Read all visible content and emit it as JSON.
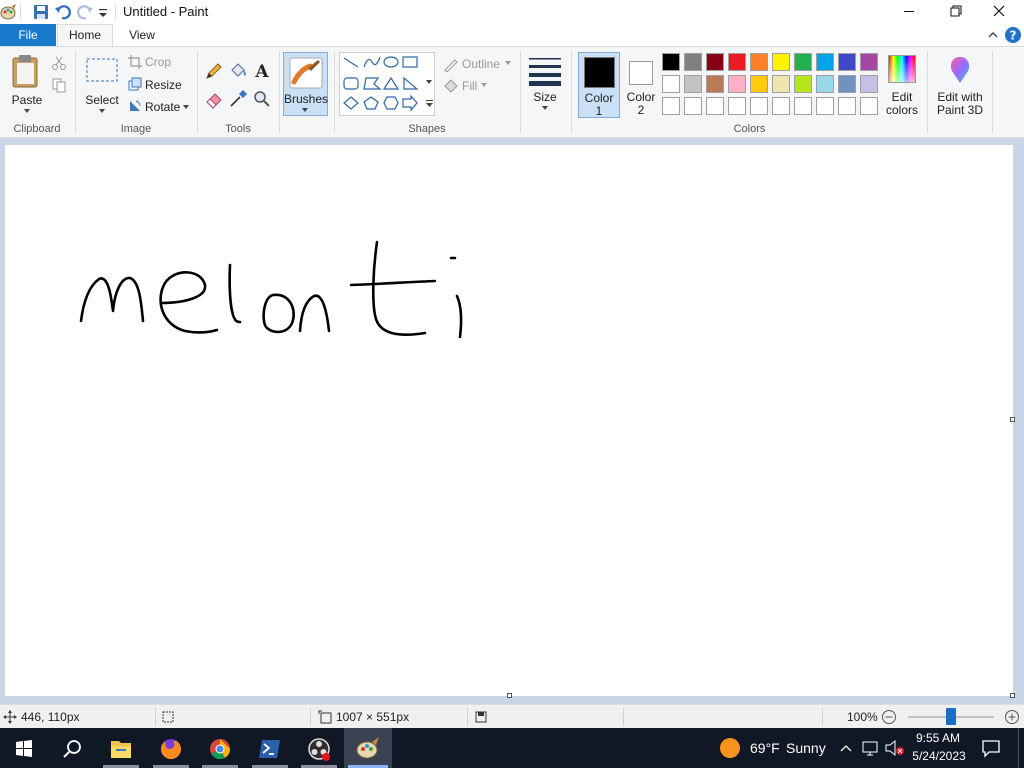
{
  "window": {
    "title": "Untitled - Paint"
  },
  "tabs": {
    "file": "File",
    "home": "Home",
    "view": "View"
  },
  "clipboard": {
    "paste": "Paste",
    "group": "Clipboard"
  },
  "image": {
    "select": "Select",
    "crop": "Crop",
    "resize": "Resize",
    "rotate": "Rotate",
    "group": "Image"
  },
  "tools": {
    "group": "Tools",
    "text_tool_glyph": "A"
  },
  "brushes": {
    "label": "Brushes"
  },
  "shapes": {
    "outline": "Outline",
    "fill": "Fill",
    "group": "Shapes"
  },
  "size": {
    "label": "Size"
  },
  "colors": {
    "color1_line1": "Color",
    "color1_line2": "1",
    "color2_line1": "Color",
    "color2_line2": "2",
    "edit_line1": "Edit",
    "edit_line2": "colors",
    "paint3d_line1": "Edit with",
    "paint3d_line2": "Paint 3D",
    "group": "Colors",
    "color1_value": "#000000",
    "color2_value": "#ffffff",
    "palette_row1": [
      "#000000",
      "#7f7f7f",
      "#880015",
      "#ed1c24",
      "#ff7f27",
      "#fff200",
      "#22b14c",
      "#00a2e8",
      "#3f48cc",
      "#a349a4"
    ],
    "palette_row2": [
      "#ffffff",
      "#c3c3c3",
      "#b97a57",
      "#ffaec9",
      "#ffc90e",
      "#efe4b0",
      "#b5e61d",
      "#99d9ea",
      "#7092be",
      "#c8bfe7"
    ],
    "palette_row3": [
      "#ffffff",
      "#ffffff",
      "#ffffff",
      "#ffffff",
      "#ffffff",
      "#ffffff",
      "#ffffff",
      "#ffffff",
      "#ffffff",
      "#ffffff"
    ]
  },
  "status": {
    "cursor_pos": "446, 110px",
    "canvas_size": "1007 × 551px",
    "zoom": "100%",
    "zoom_slider_fraction": 0.5
  },
  "taskbar": {
    "weather_temp": "69°F",
    "weather_desc": "Sunny",
    "time": "9:55 AM",
    "date": "5/24/2023",
    "apps": [
      "start-icon",
      "search-icon",
      "file-explorer-icon",
      "firefox-icon",
      "chrome-icon",
      "powershell-icon",
      "obs-icon",
      "paint-icon"
    ]
  }
}
